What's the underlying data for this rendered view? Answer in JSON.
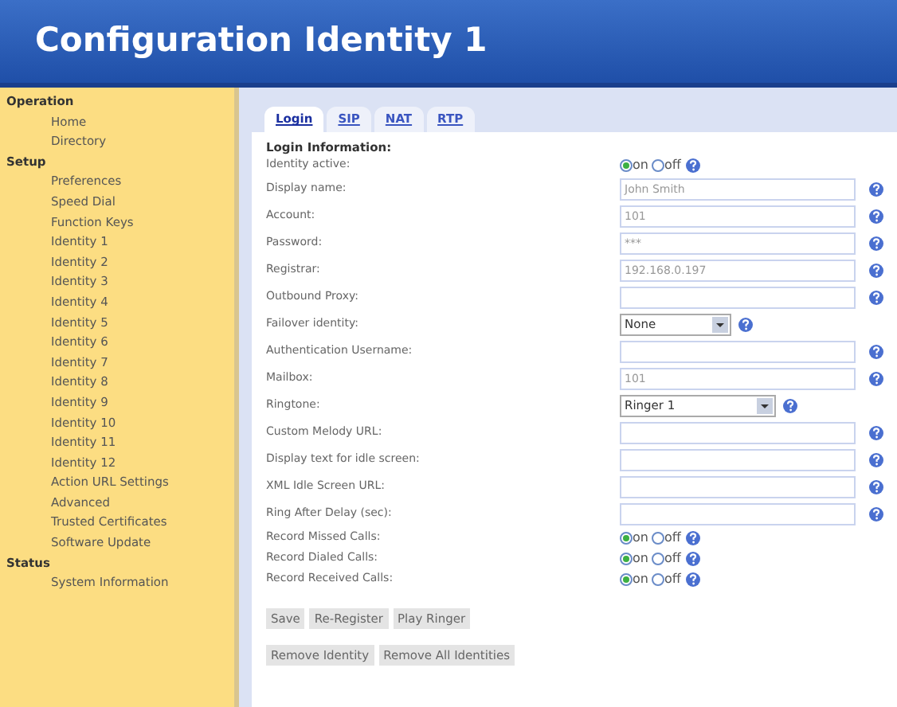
{
  "header": {
    "title": "Configuration Identity 1"
  },
  "sidebar": {
    "sections": [
      {
        "title": "Operation",
        "items": [
          {
            "label": "Home",
            "selected": false
          },
          {
            "label": "Directory",
            "selected": false
          }
        ]
      },
      {
        "title": "Setup",
        "items": [
          {
            "label": "Preferences",
            "selected": false
          },
          {
            "label": "Speed Dial",
            "selected": false
          },
          {
            "label": "Function Keys",
            "selected": false
          },
          {
            "label": "Identity 1",
            "selected": false
          },
          {
            "label": "Identity 2",
            "selected": false
          },
          {
            "label": "Identity 3",
            "selected": false
          },
          {
            "label": "Identity 4",
            "selected": false
          },
          {
            "label": "Identity 5",
            "selected": false
          },
          {
            "label": "Identity 6",
            "selected": false
          },
          {
            "label": "Identity 7",
            "selected": false
          },
          {
            "label": "Identity 8",
            "selected": false
          },
          {
            "label": "Identity 9",
            "selected": false
          },
          {
            "label": "Identity 10",
            "selected": false
          },
          {
            "label": "Identity 11",
            "selected": false
          },
          {
            "label": "Identity 12",
            "selected": false
          },
          {
            "label": "Action URL Settings",
            "selected": false
          },
          {
            "label": "Advanced",
            "selected": false
          },
          {
            "label": "Trusted Certificates",
            "selected": false
          },
          {
            "label": "Software Update",
            "selected": false
          }
        ]
      },
      {
        "title": "Status",
        "items": [
          {
            "label": "System Information",
            "selected": false
          }
        ]
      }
    ]
  },
  "tabs": [
    {
      "label": "Login",
      "selected": true
    },
    {
      "label": "SIP",
      "selected": false
    },
    {
      "label": "NAT",
      "selected": false
    },
    {
      "label": "RTP",
      "selected": false
    }
  ],
  "section_title": "Login Information:",
  "rows": [
    {
      "label": "Identity active:",
      "kind": "radio",
      "options": [
        {
          "label": "on",
          "selected": true
        },
        {
          "label": "off",
          "selected": false
        }
      ]
    },
    {
      "label": "Display name:",
      "kind": "text",
      "value": "John Smith"
    },
    {
      "label": "Account:",
      "kind": "text",
      "value": "101"
    },
    {
      "label": "Password:",
      "kind": "text",
      "value": "***"
    },
    {
      "label": "Registrar:",
      "kind": "text",
      "value": "192.168.0.197"
    },
    {
      "label": "Outbound Proxy:",
      "kind": "text"
    },
    {
      "label": "Failover identity:",
      "kind": "select",
      "value": "None"
    },
    {
      "label": "Authentication Username:",
      "kind": "text"
    },
    {
      "label": "Mailbox:",
      "kind": "text",
      "value": "101"
    },
    {
      "label": "Ringtone:",
      "kind": "select",
      "value": "Ringer 1"
    },
    {
      "label": "Custom Melody URL:",
      "kind": "text"
    },
    {
      "label": "Display text for idle screen:",
      "kind": "text"
    },
    {
      "label": "XML Idle Screen URL:",
      "kind": "text"
    },
    {
      "label": "Ring After Delay (sec):",
      "kind": "text"
    },
    {
      "label": "Record Missed Calls:",
      "kind": "radio",
      "options": [
        {
          "label": "on",
          "selected": true
        },
        {
          "label": "off",
          "selected": false
        }
      ]
    },
    {
      "label": "Record Dialed Calls:",
      "kind": "radio",
      "options": [
        {
          "label": "on",
          "selected": true
        },
        {
          "label": "off",
          "selected": false
        }
      ]
    },
    {
      "label": "Record Received Calls:",
      "kind": "radio",
      "options": [
        {
          "label": "on",
          "selected": true
        },
        {
          "label": "off",
          "selected": false
        }
      ]
    }
  ],
  "button_rows": [
    [
      "Save",
      "Re-Register",
      "Play Ringer"
    ],
    [
      "Remove Identity",
      "Remove All Identities"
    ]
  ]
}
